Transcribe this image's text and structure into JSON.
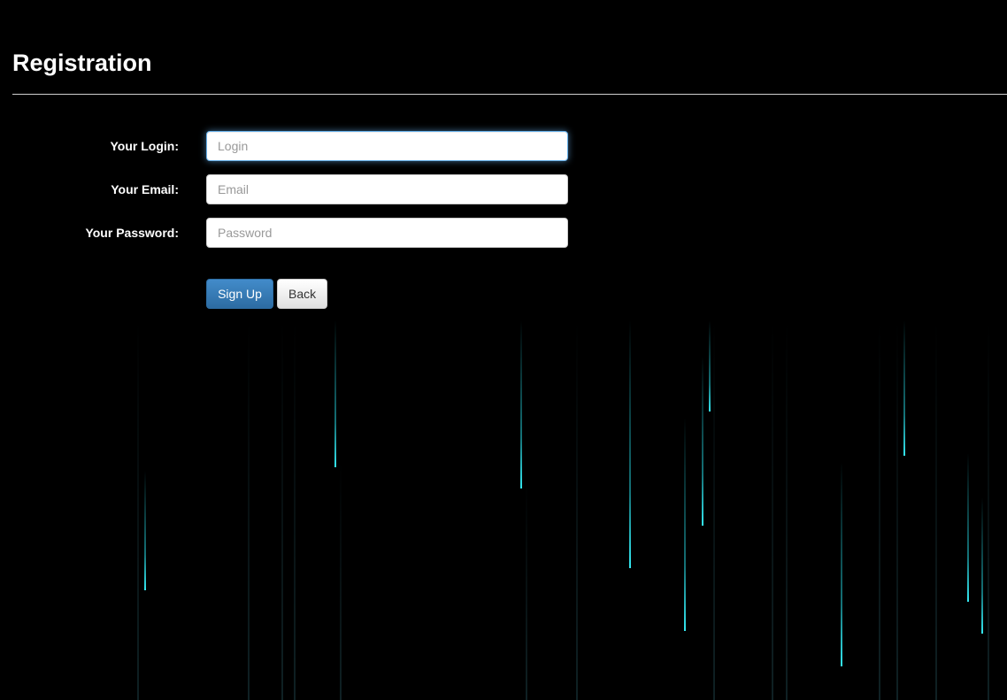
{
  "page": {
    "title": "Registration"
  },
  "form": {
    "login_label": "Your Login:",
    "login_placeholder": "Login",
    "login_value": "",
    "email_label": "Your Email:",
    "email_placeholder": "Email",
    "email_value": "",
    "password_label": "Your Password:",
    "password_placeholder": "Password",
    "password_value": ""
  },
  "buttons": {
    "signup_label": "Sign Up",
    "back_label": "Back"
  },
  "colors": {
    "background": "#000000",
    "primary_button": "#2d6ca2",
    "rain_accent": "#34e7f0"
  }
}
